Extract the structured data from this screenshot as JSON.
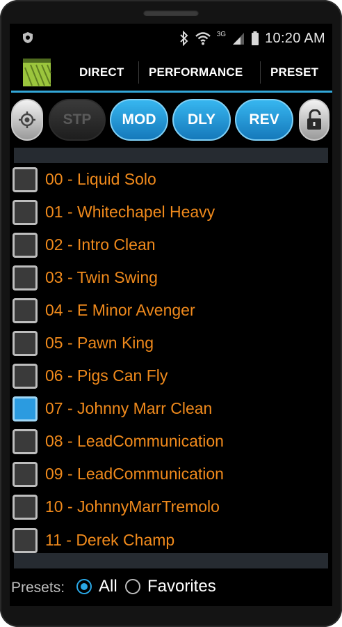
{
  "status_bar": {
    "time": "10:20 AM",
    "network_type": "3G",
    "icons": [
      "shield-icon",
      "bluetooth-icon",
      "wifi-icon",
      "signal-icon",
      "battery-icon"
    ]
  },
  "action_bar": {
    "tabs": [
      {
        "label": "DIRECT"
      },
      {
        "label": "PERFORMANCE"
      },
      {
        "label": "PRESET"
      }
    ]
  },
  "effects": {
    "left_icon": "target-icon",
    "buttons": [
      {
        "label": "STP",
        "active": false
      },
      {
        "label": "MOD",
        "active": true
      },
      {
        "label": "DLY",
        "active": true
      },
      {
        "label": "REV",
        "active": true
      }
    ],
    "right_icon": "unlocked-padlock-icon"
  },
  "presets": [
    {
      "label": "00 - Liquid Solo",
      "selected": false
    },
    {
      "label": "01 - Whitechapel Heavy",
      "selected": false
    },
    {
      "label": "02 - Intro Clean",
      "selected": false
    },
    {
      "label": "03 - Twin Swing",
      "selected": false
    },
    {
      "label": "04 - E Minor Avenger",
      "selected": false
    },
    {
      "label": "05 - Pawn King",
      "selected": false
    },
    {
      "label": "06 - Pigs Can Fly",
      "selected": false
    },
    {
      "label": "07 - Johnny Marr Clean",
      "selected": true
    },
    {
      "label": "08 - LeadCommunication",
      "selected": false
    },
    {
      "label": "09 - LeadCommunication",
      "selected": false
    },
    {
      "label": "10 - JohnnyMarrTremolo",
      "selected": false
    },
    {
      "label": "11 - Derek Champ",
      "selected": false
    }
  ],
  "filter": {
    "label": "Presets:",
    "options": [
      {
        "label": "All",
        "selected": true
      },
      {
        "label": "Favorites",
        "selected": false
      }
    ]
  },
  "colors": {
    "accent_blue": "#2b9be0",
    "preset_text": "#f08a1c",
    "divider_blue": "#33a7d8",
    "logo_green": "#9bc53d"
  }
}
